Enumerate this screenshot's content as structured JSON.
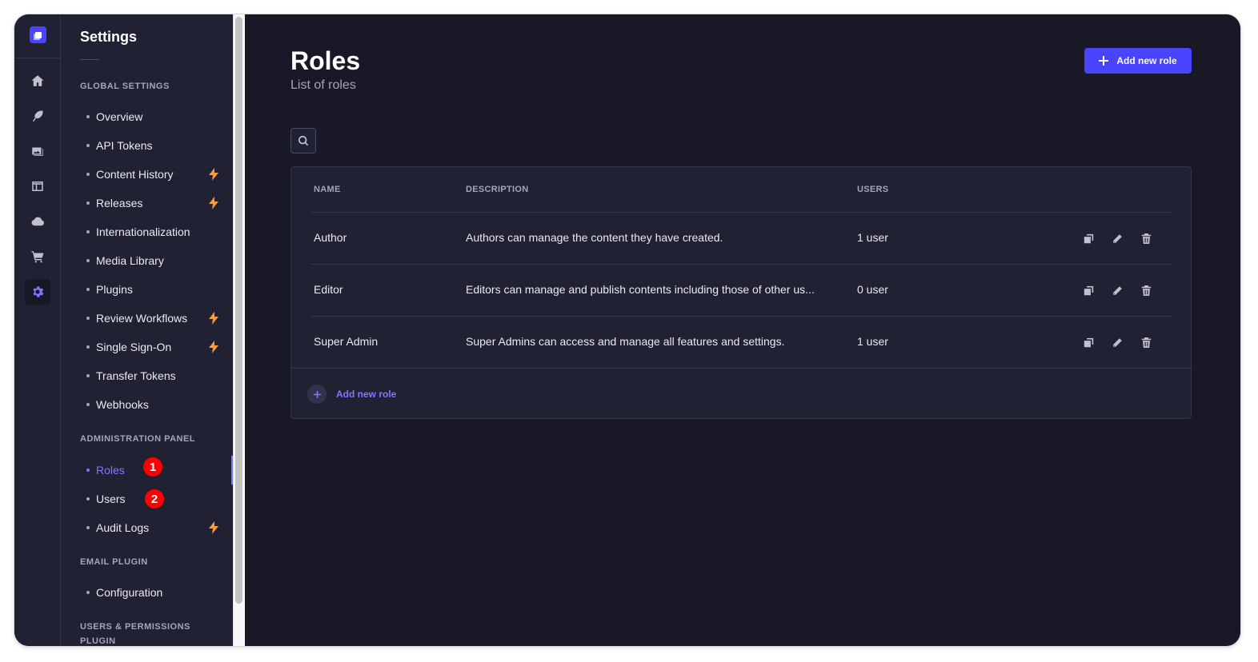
{
  "sidebar": {
    "title": "Settings",
    "sections": [
      {
        "label": "Global Settings",
        "items": [
          {
            "label": "Overview",
            "bolt": false
          },
          {
            "label": "API Tokens",
            "bolt": false
          },
          {
            "label": "Content History",
            "bolt": true
          },
          {
            "label": "Releases",
            "bolt": true
          },
          {
            "label": "Internationalization",
            "bolt": false
          },
          {
            "label": "Media Library",
            "bolt": false
          },
          {
            "label": "Plugins",
            "bolt": false
          },
          {
            "label": "Review Workflows",
            "bolt": true
          },
          {
            "label": "Single Sign-On",
            "bolt": true
          },
          {
            "label": "Transfer Tokens",
            "bolt": false
          },
          {
            "label": "Webhooks",
            "bolt": false
          }
        ]
      },
      {
        "label": "Administration Panel",
        "items": [
          {
            "label": "Roles",
            "bolt": false,
            "active": true
          },
          {
            "label": "Users",
            "bolt": false
          },
          {
            "label": "Audit Logs",
            "bolt": true
          }
        ]
      },
      {
        "label": "Email Plugin",
        "items": [
          {
            "label": "Configuration",
            "bolt": false
          }
        ]
      },
      {
        "label": "Users & Permissions Plugin",
        "items": []
      }
    ]
  },
  "rail": {
    "icons": [
      "home-icon",
      "feather-icon",
      "media-icon",
      "layout-icon",
      "cloud-icon",
      "cart-icon",
      "settings-gear-icon"
    ],
    "active": "settings-gear-icon"
  },
  "badges": [
    "1",
    "2"
  ],
  "header": {
    "title": "Roles",
    "subtitle": "List of roles",
    "add_button": "Add new role"
  },
  "table": {
    "columns": [
      "Name",
      "Description",
      "Users"
    ],
    "rows": [
      {
        "name": "Author",
        "description": "Authors can manage the content they have created.",
        "users": "1 user"
      },
      {
        "name": "Editor",
        "description": "Editors can manage and publish contents including those of other us...",
        "users": "0 user"
      },
      {
        "name": "Super Admin",
        "description": "Super Admins can access and manage all features and settings.",
        "users": "1 user"
      }
    ],
    "footer_add": "Add new role"
  },
  "colors": {
    "primary": "#4945ff",
    "primary_light": "#7b79ff",
    "background": "#181826",
    "panel": "#212134",
    "bolt": "#f29d41",
    "badge": "#ff0000"
  }
}
